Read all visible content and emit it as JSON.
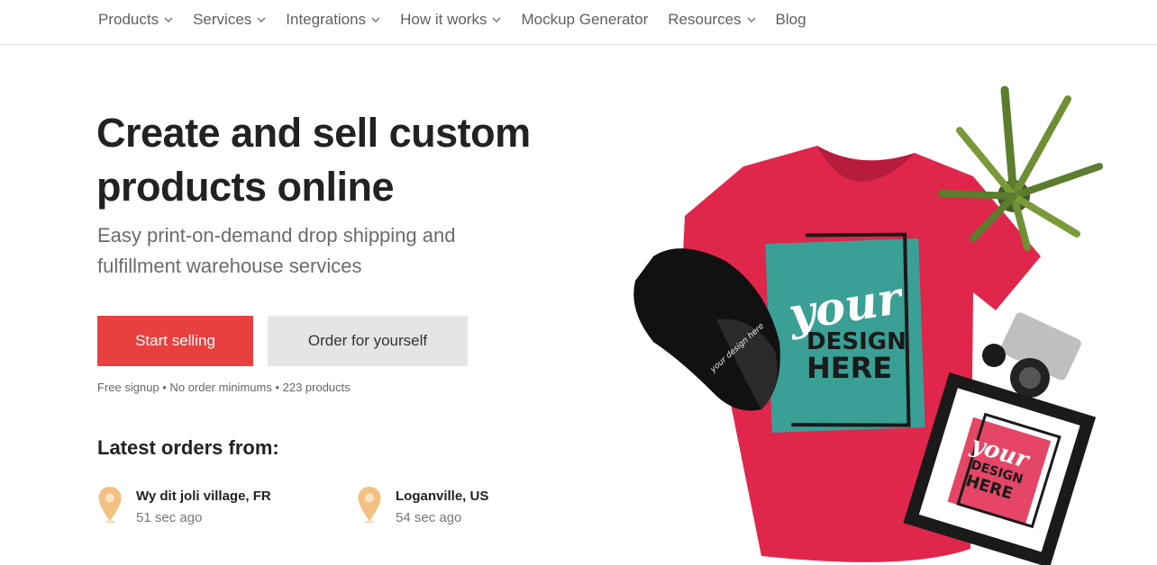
{
  "nav": {
    "items": [
      {
        "label": "Products",
        "dropdown": true
      },
      {
        "label": "Services",
        "dropdown": true
      },
      {
        "label": "Integrations",
        "dropdown": true
      },
      {
        "label": "How it works",
        "dropdown": true
      },
      {
        "label": "Mockup Generator",
        "dropdown": false
      },
      {
        "label": "Resources",
        "dropdown": true
      },
      {
        "label": "Blog",
        "dropdown": false
      }
    ]
  },
  "hero": {
    "title_line1": "Create and sell custom",
    "title_line2": "products online",
    "subtitle_line1": "Easy print-on-demand drop shipping and",
    "subtitle_line2": "fulfillment warehouse services",
    "primary_button": "Start selling",
    "secondary_button": "Order for yourself",
    "footnote": "Free signup • No order minimums • 223 products"
  },
  "latest_orders": {
    "heading": "Latest orders from:",
    "orders": [
      {
        "city": "Wy dit joli village, FR",
        "ago": "51 sec ago"
      },
      {
        "city": "Loganville, US",
        "ago": "54 sec ago"
      }
    ]
  },
  "image": {
    "shirt_text_1": "your",
    "shirt_text_2": "DESIGN",
    "shirt_text_3": "HERE",
    "frame_text_1": "your",
    "frame_text_2": "DESIGN",
    "frame_text_3": "HERE",
    "cap_text": "your design here"
  },
  "colors": {
    "accent": "#e8403e",
    "secondary_button": "#e5e5e5",
    "pin": "#f2c181",
    "shirt": "#e0264b",
    "teal": "#3a9f94"
  }
}
